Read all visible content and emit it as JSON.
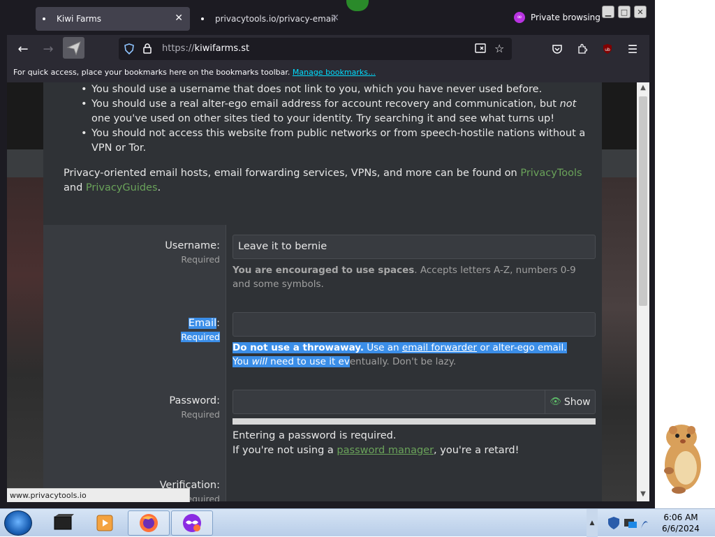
{
  "browser": {
    "tabs": [
      {
        "label": "Kiwi Farms",
        "active": true
      },
      {
        "label": "privacytools.io/privacy-email",
        "active": false
      }
    ],
    "private_label": "Private browsing",
    "url_protocol": "https://",
    "url_host": "kiwifarms.st",
    "bookmarks_message": "For quick access, place your bookmarks here on the bookmarks toolbar.",
    "bookmarks_link": "Manage bookmarks…",
    "status_url": "www.privacytools.io"
  },
  "content": {
    "bullets": [
      "You should use a username that does not link to you, which you have never used before.",
      "You should use a real alter-ego email address for account recovery and communication, but",
      "You should not access this website from public networks or from speech-hostile nations without a VPN or Tor."
    ],
    "bullet2_em": "not",
    "bullet2_tail": "one you've used on other sites tied to your identity. Try searching it and see what turns up!",
    "privacy_para_prefix": "Privacy-oriented email hosts, email forwarding services, VPNs, and more can be found on",
    "privacy_link1": "PrivacyTools",
    "privacy_and": "and",
    "privacy_link2": "PrivacyGuides",
    "privacy_end": "."
  },
  "form": {
    "username": {
      "label": "Username:",
      "required": "Required",
      "value": "Leave it to bernie",
      "hint_bold": "You are encouraged to use spaces",
      "hint_rest": ". Accepts letters A-Z, numbers 0-9 and some symbols."
    },
    "email": {
      "label": "Email",
      "colon": ":",
      "required": "Required",
      "value": "",
      "hint_bold": "Do not use a throwaway.",
      "hint_mid": " Use an ",
      "hint_link": "email forwarder",
      "hint_tail": " or alter-ego email.",
      "hint_line2_a": "You ",
      "hint_line2_em": "will",
      "hint_line2_b": " need to use it ev",
      "hint_line2_c": "entually. Don't be lazy."
    },
    "password": {
      "label": "Password:",
      "required": "Required",
      "show_label": "Show",
      "msg1": "Entering a password is required.",
      "msg2_prefix": "If you're not using a ",
      "msg2_link": "password manager",
      "msg2_suffix": ", you're a retard!"
    },
    "verification": {
      "label": "Verification:",
      "required": "Required"
    }
  },
  "taskbar": {
    "time": "6:06 AM",
    "date": "6/6/2024"
  }
}
